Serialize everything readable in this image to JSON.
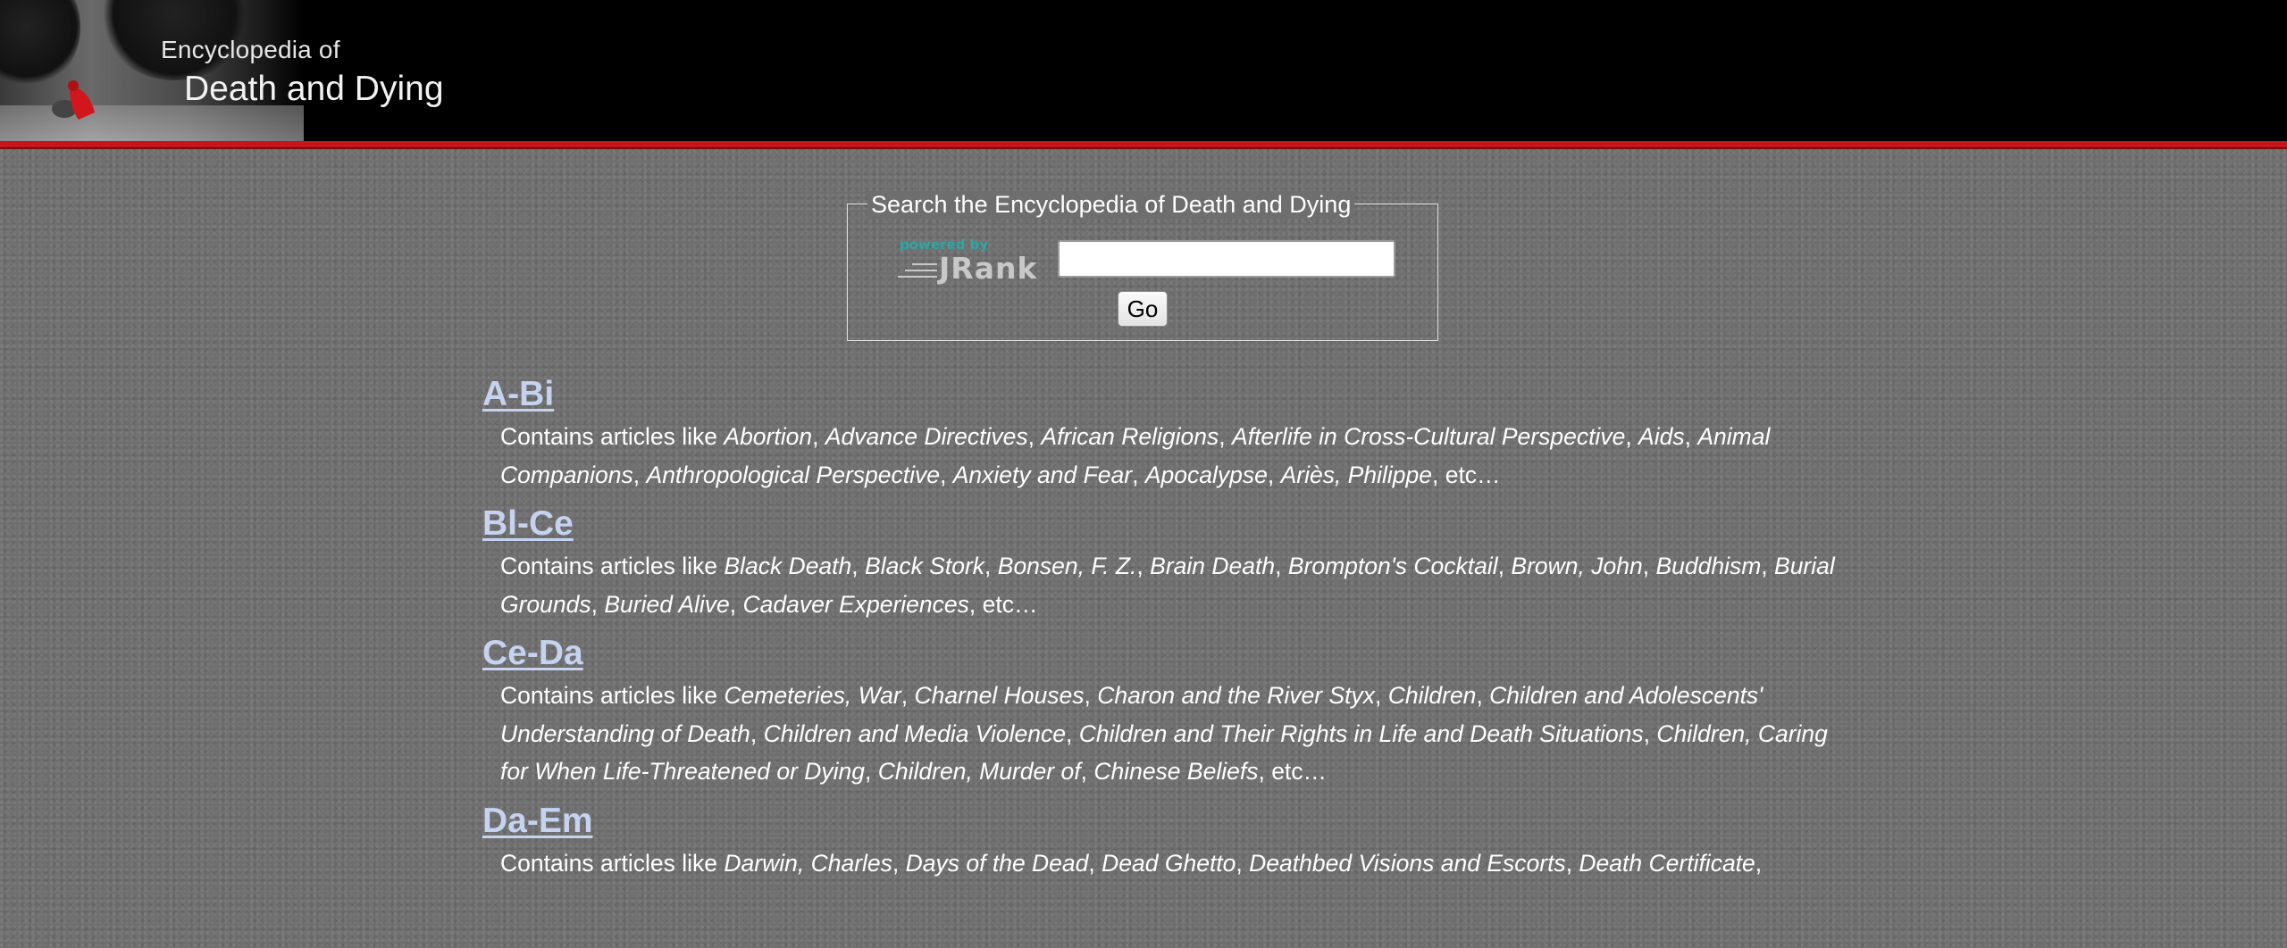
{
  "header": {
    "title_small": "Encyclopedia of",
    "title_large": "Death and Dying"
  },
  "search": {
    "legend": "Search the Encyclopedia of Death and Dying",
    "powered_by": "powered by",
    "brand": "JRank",
    "input_value": "",
    "button_label": "Go"
  },
  "sections": [
    {
      "heading": "A-Bi",
      "intro": "Contains articles like ",
      "articles": [
        "Abortion",
        "Advance Directives",
        "African Religions",
        "Afterlife in Cross-Cultural Perspective",
        "Aids",
        "Animal Companions",
        "Anthropological Perspective",
        "Anxiety and Fear",
        "Apocalypse",
        "Ariès, Philippe"
      ],
      "outro": "etc…"
    },
    {
      "heading": "Bl-Ce",
      "intro": "Contains articles like ",
      "articles": [
        "Black Death",
        "Black Stork",
        "Bonsen, F. Z.",
        "Brain Death",
        "Brompton's Cocktail",
        "Brown, John",
        "Buddhism",
        "Burial Grounds",
        "Buried Alive",
        "Cadaver Experiences"
      ],
      "outro": "etc…"
    },
    {
      "heading": "Ce-Da",
      "intro": "Contains articles like ",
      "articles": [
        "Cemeteries, War",
        "Charnel Houses",
        "Charon and the River Styx",
        "Children",
        "Children and Adolescents' Understanding of Death",
        "Children and Media Violence",
        "Children and Their Rights in Life and Death Situations",
        "Children, Caring for When Life-Threatened or Dying",
        "Children, Murder of",
        "Chinese Beliefs"
      ],
      "outro": "etc…"
    },
    {
      "heading": "Da-Em",
      "intro": "Contains articles like ",
      "articles": [
        "Darwin, Charles",
        "Days of the Dead",
        "Dead Ghetto",
        "Deathbed Visions and Escorts",
        "Death Certificate"
      ],
      "outro": ""
    }
  ]
}
